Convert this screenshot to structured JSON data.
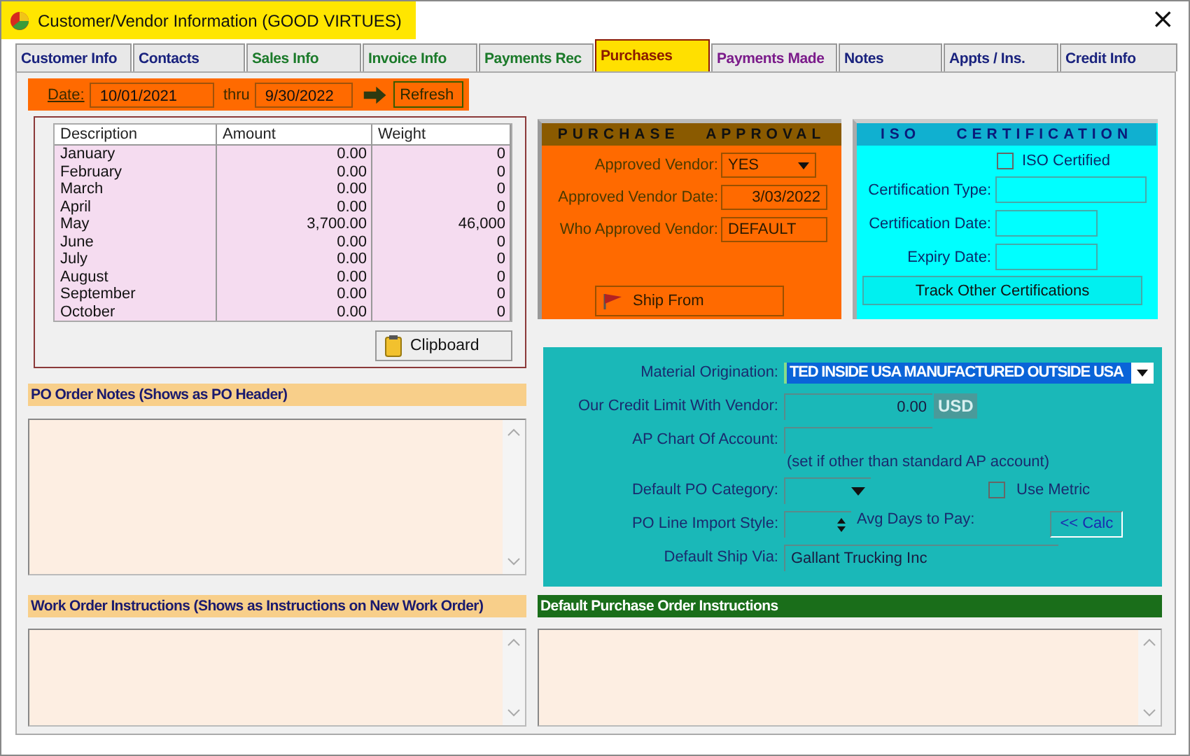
{
  "window": {
    "title": "Customer/Vendor Information  (GOOD VIRTUES)",
    "close": "×"
  },
  "tabs": [
    {
      "label": "Customer Info",
      "selected": false,
      "color": "#1a237e"
    },
    {
      "label": "Contacts",
      "selected": false,
      "color": "#1a237e"
    },
    {
      "label": "Sales Info",
      "selected": false,
      "color": "#1b7a2a"
    },
    {
      "label": "Invoice Info",
      "selected": false,
      "color": "#1b7a2a"
    },
    {
      "label": "Payments Rec",
      "selected": false,
      "color": "#1b7a2a"
    },
    {
      "label": "Purchases",
      "selected": true,
      "color": "#8b1a00"
    },
    {
      "label": "Payments Made",
      "selected": false,
      "color": "#7b1b8a"
    },
    {
      "label": "Notes",
      "selected": false,
      "color": "#1a237e"
    },
    {
      "label": "Appts / Ins.",
      "selected": false,
      "color": "#1a237e"
    },
    {
      "label": "Credit Info",
      "selected": false,
      "color": "#1a237e"
    }
  ],
  "date_bar": {
    "date_label": "Date:",
    "from": "10/01/2021",
    "thru_label": "thru",
    "to": "9/30/2022",
    "refresh": "Refresh"
  },
  "monthly_table": {
    "columns": [
      "Description",
      "Amount",
      "Weight"
    ],
    "rows": [
      [
        "January",
        "0.00",
        "0"
      ],
      [
        "February",
        "0.00",
        "0"
      ],
      [
        "March",
        "0.00",
        "0"
      ],
      [
        "April",
        "0.00",
        "0"
      ],
      [
        "May",
        "3,700.00",
        "46,000"
      ],
      [
        "June",
        "0.00",
        "0"
      ],
      [
        "July",
        "0.00",
        "0"
      ],
      [
        "August",
        "0.00",
        "0"
      ],
      [
        "September",
        "0.00",
        "0"
      ],
      [
        "October",
        "0.00",
        "0"
      ]
    ],
    "clipboard": "Clipboard"
  },
  "purchase_approval": {
    "title": "PURCHASE   APPROVAL",
    "fields": [
      {
        "label": "Approved Vendor:",
        "value": "YES",
        "kind": "dropdown"
      },
      {
        "label": "Approved Vendor Date:",
        "value": "3/03/2022",
        "kind": "date"
      },
      {
        "label": "Who Approved Vendor:",
        "value": "DEFAULT",
        "kind": "text"
      }
    ],
    "ship_from": "Ship From"
  },
  "iso_certification": {
    "title": "ISO    CERTIFICATION",
    "certified": {
      "label": "ISO Certified",
      "checked": false
    },
    "fields": [
      {
        "label": "Certification Type:",
        "kind": "wide"
      },
      {
        "label": "Certification Date:",
        "kind": "narrow"
      },
      {
        "label": "Expiry Date:",
        "kind": "narrow"
      }
    ],
    "track_button": "Track Other Certifications"
  },
  "vendor_settings": {
    "material_origination": {
      "label": "Material Origination:",
      "value": "TED INSIDE USA MANUFACTURED OUTSIDE USA"
    },
    "credit_limit": {
      "label": "Our Credit Limit With Vendor:",
      "value": "0.00",
      "currency": "USD"
    },
    "ap_chart": {
      "label": "AP Chart Of Account:",
      "note": "(set if other than standard AP account)"
    },
    "po_category": {
      "label": "Default PO Category:"
    },
    "use_metric": {
      "label": "Use Metric",
      "checked": false
    },
    "import_style": {
      "label": "PO Line Import Style:"
    },
    "avg_days": {
      "label": "Avg Days to Pay:"
    },
    "calc": "<< Calc",
    "ship_via": {
      "label": "Default Ship Via:",
      "value": "Gallant Trucking Inc"
    }
  },
  "po_order_notes": {
    "title": "PO Order Notes (Shows as PO Header)"
  },
  "work_order_instructions": {
    "title": "Work Order Instructions  (Shows as Instructions on  New Work Order)"
  },
  "default_po_instructions": {
    "title": "Default Purchase Order Instructions"
  }
}
